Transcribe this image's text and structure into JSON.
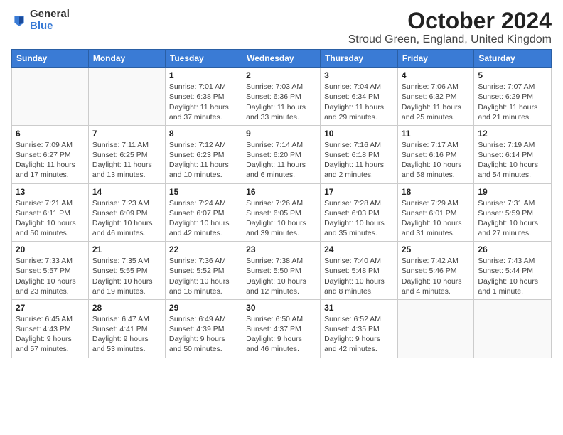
{
  "logo": {
    "general": "General",
    "blue": "Blue"
  },
  "title": "October 2024",
  "subtitle": "Stroud Green, England, United Kingdom",
  "days_of_week": [
    "Sunday",
    "Monday",
    "Tuesday",
    "Wednesday",
    "Thursday",
    "Friday",
    "Saturday"
  ],
  "weeks": [
    [
      {
        "day": "",
        "info": ""
      },
      {
        "day": "",
        "info": ""
      },
      {
        "day": "1",
        "info": "Sunrise: 7:01 AM\nSunset: 6:38 PM\nDaylight: 11 hours and 37 minutes."
      },
      {
        "day": "2",
        "info": "Sunrise: 7:03 AM\nSunset: 6:36 PM\nDaylight: 11 hours and 33 minutes."
      },
      {
        "day": "3",
        "info": "Sunrise: 7:04 AM\nSunset: 6:34 PM\nDaylight: 11 hours and 29 minutes."
      },
      {
        "day": "4",
        "info": "Sunrise: 7:06 AM\nSunset: 6:32 PM\nDaylight: 11 hours and 25 minutes."
      },
      {
        "day": "5",
        "info": "Sunrise: 7:07 AM\nSunset: 6:29 PM\nDaylight: 11 hours and 21 minutes."
      }
    ],
    [
      {
        "day": "6",
        "info": "Sunrise: 7:09 AM\nSunset: 6:27 PM\nDaylight: 11 hours and 17 minutes."
      },
      {
        "day": "7",
        "info": "Sunrise: 7:11 AM\nSunset: 6:25 PM\nDaylight: 11 hours and 13 minutes."
      },
      {
        "day": "8",
        "info": "Sunrise: 7:12 AM\nSunset: 6:23 PM\nDaylight: 11 hours and 10 minutes."
      },
      {
        "day": "9",
        "info": "Sunrise: 7:14 AM\nSunset: 6:20 PM\nDaylight: 11 hours and 6 minutes."
      },
      {
        "day": "10",
        "info": "Sunrise: 7:16 AM\nSunset: 6:18 PM\nDaylight: 11 hours and 2 minutes."
      },
      {
        "day": "11",
        "info": "Sunrise: 7:17 AM\nSunset: 6:16 PM\nDaylight: 10 hours and 58 minutes."
      },
      {
        "day": "12",
        "info": "Sunrise: 7:19 AM\nSunset: 6:14 PM\nDaylight: 10 hours and 54 minutes."
      }
    ],
    [
      {
        "day": "13",
        "info": "Sunrise: 7:21 AM\nSunset: 6:11 PM\nDaylight: 10 hours and 50 minutes."
      },
      {
        "day": "14",
        "info": "Sunrise: 7:23 AM\nSunset: 6:09 PM\nDaylight: 10 hours and 46 minutes."
      },
      {
        "day": "15",
        "info": "Sunrise: 7:24 AM\nSunset: 6:07 PM\nDaylight: 10 hours and 42 minutes."
      },
      {
        "day": "16",
        "info": "Sunrise: 7:26 AM\nSunset: 6:05 PM\nDaylight: 10 hours and 39 minutes."
      },
      {
        "day": "17",
        "info": "Sunrise: 7:28 AM\nSunset: 6:03 PM\nDaylight: 10 hours and 35 minutes."
      },
      {
        "day": "18",
        "info": "Sunrise: 7:29 AM\nSunset: 6:01 PM\nDaylight: 10 hours and 31 minutes."
      },
      {
        "day": "19",
        "info": "Sunrise: 7:31 AM\nSunset: 5:59 PM\nDaylight: 10 hours and 27 minutes."
      }
    ],
    [
      {
        "day": "20",
        "info": "Sunrise: 7:33 AM\nSunset: 5:57 PM\nDaylight: 10 hours and 23 minutes."
      },
      {
        "day": "21",
        "info": "Sunrise: 7:35 AM\nSunset: 5:55 PM\nDaylight: 10 hours and 19 minutes."
      },
      {
        "day": "22",
        "info": "Sunrise: 7:36 AM\nSunset: 5:52 PM\nDaylight: 10 hours and 16 minutes."
      },
      {
        "day": "23",
        "info": "Sunrise: 7:38 AM\nSunset: 5:50 PM\nDaylight: 10 hours and 12 minutes."
      },
      {
        "day": "24",
        "info": "Sunrise: 7:40 AM\nSunset: 5:48 PM\nDaylight: 10 hours and 8 minutes."
      },
      {
        "day": "25",
        "info": "Sunrise: 7:42 AM\nSunset: 5:46 PM\nDaylight: 10 hours and 4 minutes."
      },
      {
        "day": "26",
        "info": "Sunrise: 7:43 AM\nSunset: 5:44 PM\nDaylight: 10 hours and 1 minute."
      }
    ],
    [
      {
        "day": "27",
        "info": "Sunrise: 6:45 AM\nSunset: 4:43 PM\nDaylight: 9 hours and 57 minutes."
      },
      {
        "day": "28",
        "info": "Sunrise: 6:47 AM\nSunset: 4:41 PM\nDaylight: 9 hours and 53 minutes."
      },
      {
        "day": "29",
        "info": "Sunrise: 6:49 AM\nSunset: 4:39 PM\nDaylight: 9 hours and 50 minutes."
      },
      {
        "day": "30",
        "info": "Sunrise: 6:50 AM\nSunset: 4:37 PM\nDaylight: 9 hours and 46 minutes."
      },
      {
        "day": "31",
        "info": "Sunrise: 6:52 AM\nSunset: 4:35 PM\nDaylight: 9 hours and 42 minutes."
      },
      {
        "day": "",
        "info": ""
      },
      {
        "day": "",
        "info": ""
      }
    ]
  ]
}
